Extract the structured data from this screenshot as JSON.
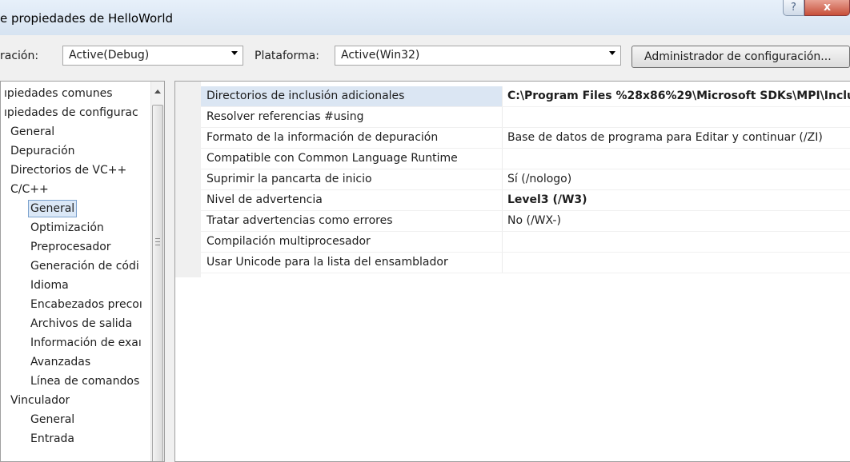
{
  "window": {
    "title": "e propiedades de HelloWorld",
    "help_glyph": "?",
    "close_glyph": "x"
  },
  "toolbar": {
    "config_label": "ración:",
    "config_value": "Active(Debug)",
    "platform_label": "Plataforma:",
    "platform_value": "Active(Win32)",
    "manager_button": "Administrador de configuración..."
  },
  "tree": {
    "items": [
      {
        "label": "ıpiedades comunes"
      },
      {
        "label": "ıpiedades de configurac"
      },
      {
        "label": "General"
      },
      {
        "label": "Depuración"
      },
      {
        "label": "Directorios de VC++"
      },
      {
        "label": "C/C++"
      },
      {
        "label": "General",
        "selected": true
      },
      {
        "label": "Optimización"
      },
      {
        "label": "Preprocesador"
      },
      {
        "label": "Generación de códi"
      },
      {
        "label": "Idioma"
      },
      {
        "label": "Encabezados precoı"
      },
      {
        "label": "Archivos de salida"
      },
      {
        "label": "Información de exaı"
      },
      {
        "label": "Avanzadas"
      },
      {
        "label": "Línea de comandos"
      },
      {
        "label": "Vinculador"
      },
      {
        "label": "General"
      },
      {
        "label": "Entrada"
      }
    ]
  },
  "properties": [
    {
      "name": "Directorios de inclusión adicionales",
      "value": "C:\\Program Files %28x86%29\\Microsoft SDKs\\MPI\\Inclu",
      "bold": true,
      "highlight": true
    },
    {
      "name": "Resolver referencias #using",
      "value": ""
    },
    {
      "name": "Formato de la información de depuración",
      "value": "Base de datos de programa para Editar y continuar (/ZI)"
    },
    {
      "name": "Compatible con Common Language Runtime",
      "value": ""
    },
    {
      "name": "Suprimir la pancarta de inicio",
      "value": "Sí (/nologo)"
    },
    {
      "name": "Nivel de advertencia",
      "value": "Level3 (/W3)",
      "bold": true
    },
    {
      "name": "Tratar advertencias como errores",
      "value": "No (/WX-)"
    },
    {
      "name": "Compilación multiprocesador",
      "value": ""
    },
    {
      "name": "Usar Unicode para la lista del ensamblador",
      "value": ""
    }
  ]
}
